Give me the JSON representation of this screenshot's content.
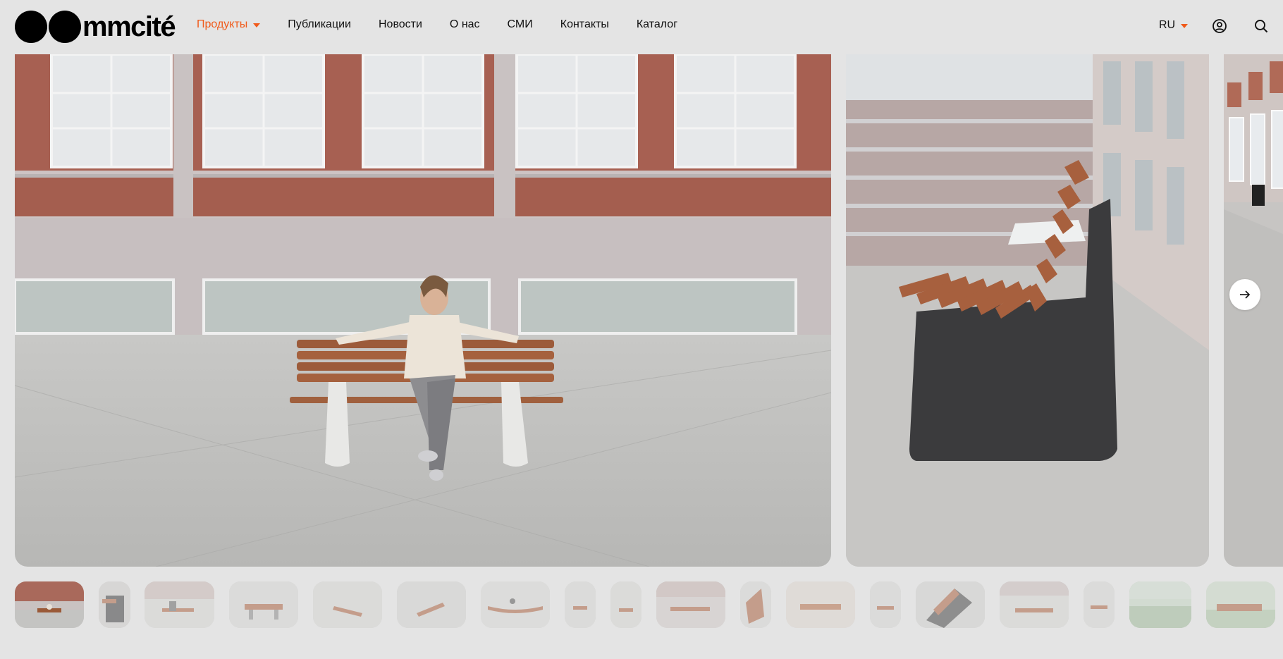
{
  "brand": {
    "name": "mmcité"
  },
  "nav": {
    "items": [
      {
        "label": "Продукты",
        "active": true,
        "has_dropdown": true
      },
      {
        "label": "Публикации"
      },
      {
        "label": "Новости"
      },
      {
        "label": "О нас"
      },
      {
        "label": "СМИ"
      },
      {
        "label": "Контакты"
      },
      {
        "label": "Каталог"
      }
    ]
  },
  "header": {
    "language": "RU",
    "icons": [
      "user-icon",
      "search-icon"
    ]
  },
  "gallery": {
    "slides": [
      {
        "name": "bench-with-woman-slide"
      },
      {
        "name": "bench-side-view-slide"
      },
      {
        "name": "building-partial-slide"
      }
    ],
    "next_icon": "arrow-right-icon",
    "thumbnail_count": 19
  },
  "colors": {
    "accent": "#f05a1a",
    "background": "#e4e4e4",
    "text": "#111111"
  }
}
